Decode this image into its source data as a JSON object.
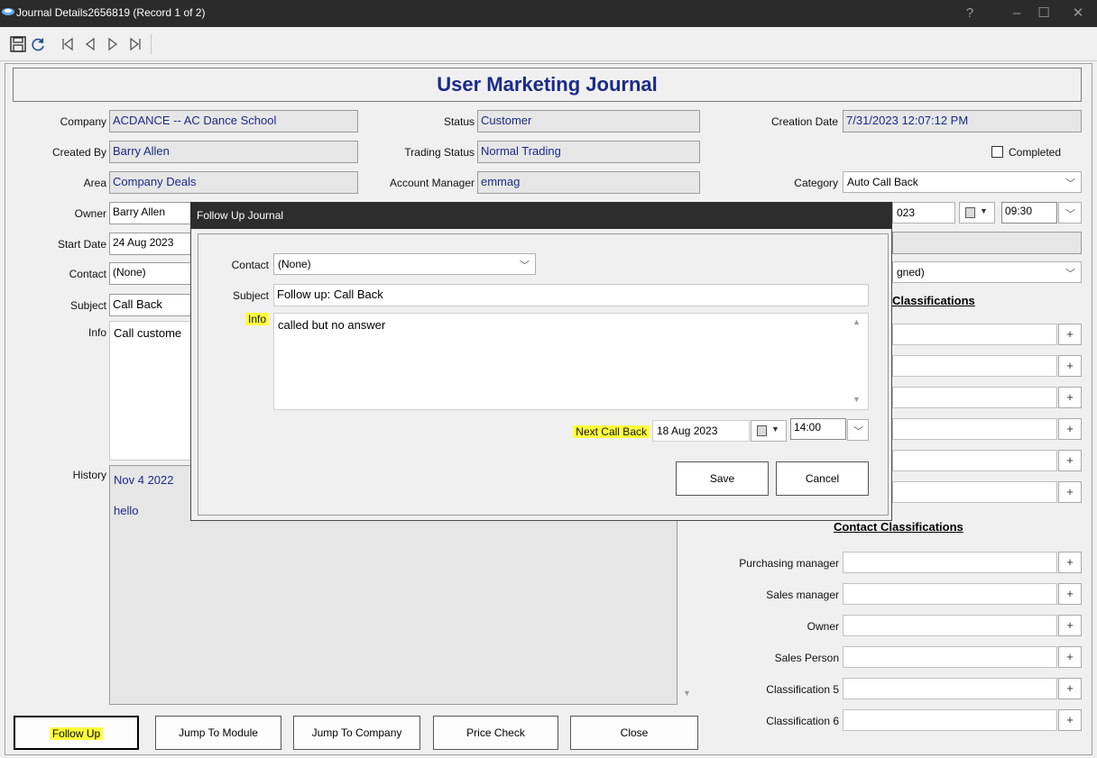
{
  "window": {
    "title": "Journal Details2656819  (Record 1 of 2)",
    "help": "?",
    "minimize": "–",
    "maximize": "☐",
    "close": "✕"
  },
  "toolbar": {
    "icons": [
      "save-icon",
      "refresh-icon",
      "first-record-icon",
      "previous-record-icon",
      "next-record-icon",
      "last-record-icon"
    ]
  },
  "header": {
    "title": "User Marketing Journal"
  },
  "form": {
    "company_label": "Company",
    "company": "ACDANCE -- AC Dance School",
    "created_by_label": "Created By",
    "created_by": "Barry Allen",
    "area_label": "Area",
    "area": "Company Deals",
    "owner_label": "Owner",
    "owner": "Barry Allen",
    "start_date_label": "Start Date",
    "start_date": "24 Aug 2023",
    "contact_label": "Contact",
    "contact": "(None)",
    "subject_label": "Subject",
    "subject": "Call Back",
    "info_label": "Info",
    "info": "Call custome",
    "history_label": "History",
    "history_date": "Nov  4 2022",
    "history_text": "hello",
    "status_label": "Status",
    "status": "Customer",
    "trading_status_label": "Trading Status",
    "trading_status": "Normal Trading",
    "account_manager_label": "Account Manager",
    "account_manager": "emmag",
    "creation_date_label": "Creation Date",
    "creation_date": "7/31/2023 12:07:12 PM",
    "completed_label": "Completed",
    "category_label": "Category",
    "category": "Auto Call Back",
    "due_date_partial": "023",
    "due_time": "09:30",
    "assigned_partial": "gned)",
    "company_classifications_partial": "Classifications"
  },
  "contact_classifications": {
    "title": "Contact Classifications",
    "items": [
      "Purchasing manager",
      "Sales manager",
      "Owner",
      "Sales Person",
      "Classification 5",
      "Classification 6"
    ]
  },
  "buttons": {
    "follow_up": "Follow Up",
    "jump_to_module": "Jump To Module",
    "jump_to_company": "Jump To Company",
    "price_check": "Price Check",
    "close": "Close",
    "plus": "+"
  },
  "dialog": {
    "title": "Follow Up Journal",
    "contact_label": "Contact",
    "contact": "(None)",
    "subject_label": "Subject",
    "subject": "Follow up: Call Back",
    "info_label": "Info",
    "info": "called but no answer",
    "next_call_back_label": "Next Call Back",
    "next_call_back_date": "18 Aug 2023",
    "next_call_back_time": "14:00",
    "save": "Save",
    "cancel": "Cancel"
  },
  "colors": {
    "highlight": "#ffff3d",
    "field_text": "#1a2a8a",
    "titlebar": "#2b2b2b"
  }
}
